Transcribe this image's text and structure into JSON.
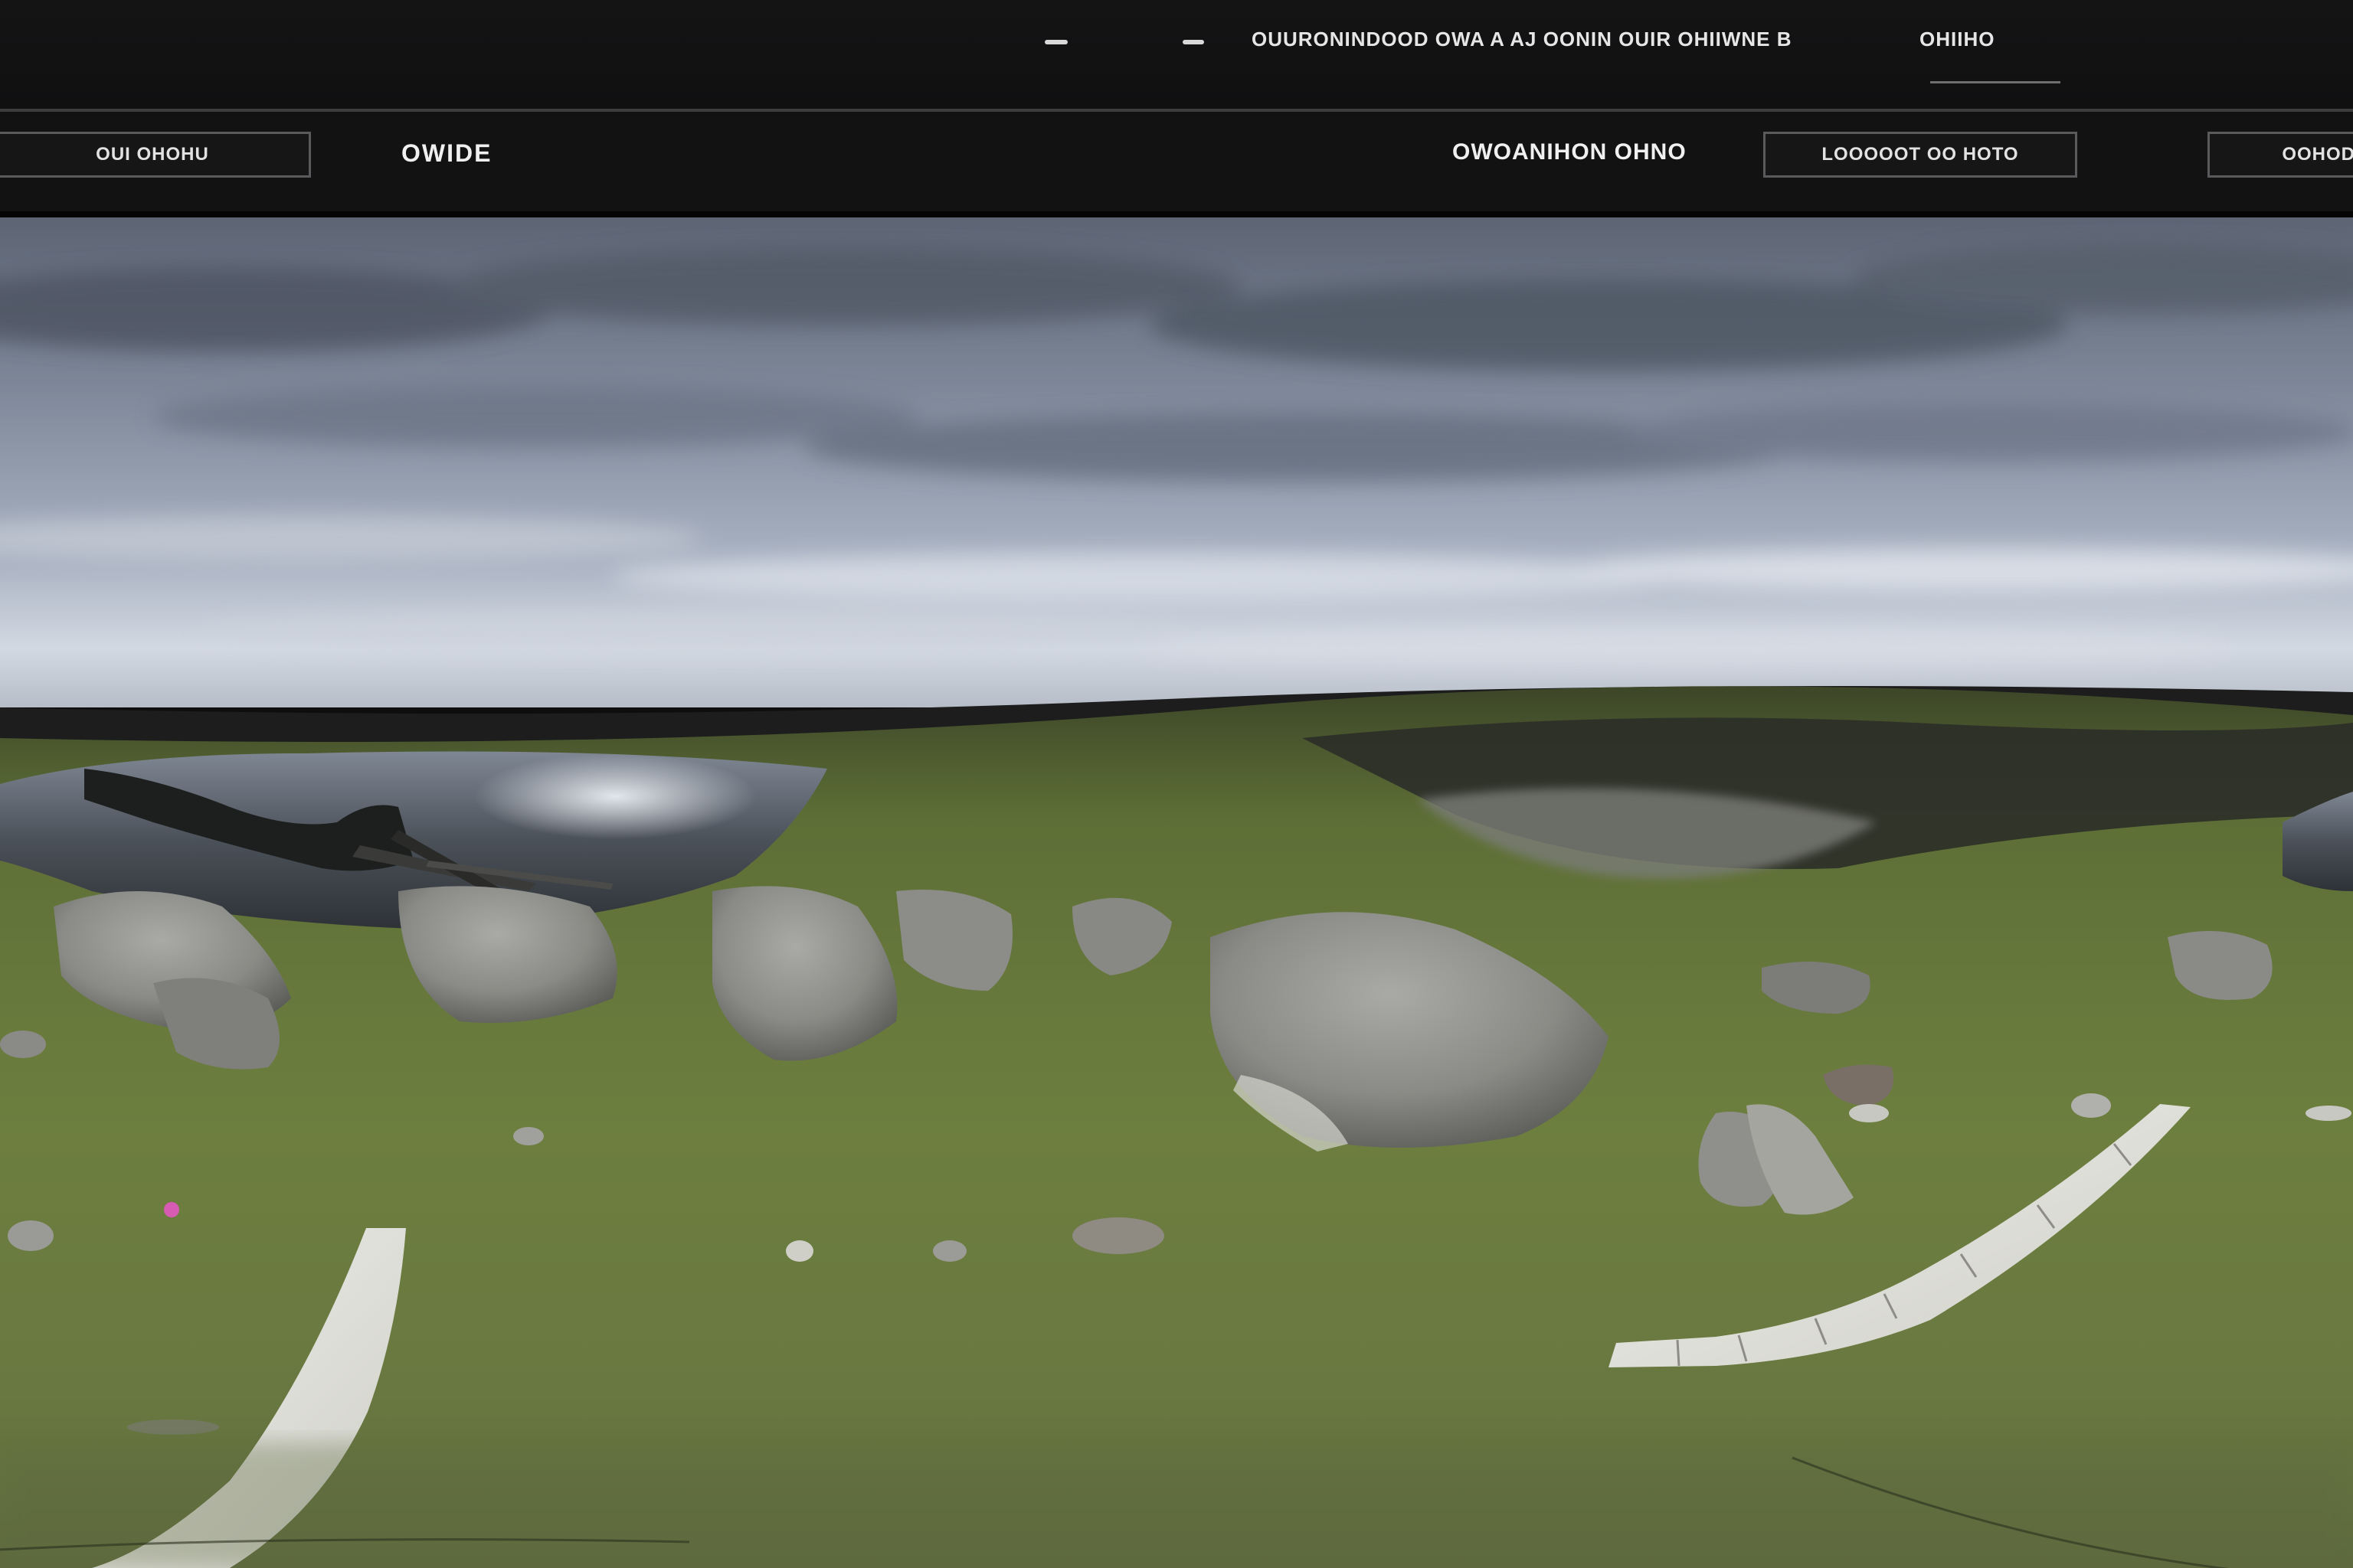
{
  "top_bar": {
    "text_1": "—",
    "text_2": "—",
    "status_text": "OUURONINDOOD OWA A  AJ OONIN OUIR OHIIWNE B",
    "right_text": "OHIIHO"
  },
  "toolbar": {
    "left_button": "OUI OHOHU",
    "title": "OWIDE",
    "center_label": "OWOANIHON OHNO",
    "right_button": "LOOOOOT OO HOTO",
    "far_right_button": "OOHOD"
  },
  "viewport": {
    "type": "equirectangular-panorama",
    "sky_color": "#8d97a8",
    "grass_color": "#6b7d3e",
    "water_color": "#4f5560"
  }
}
